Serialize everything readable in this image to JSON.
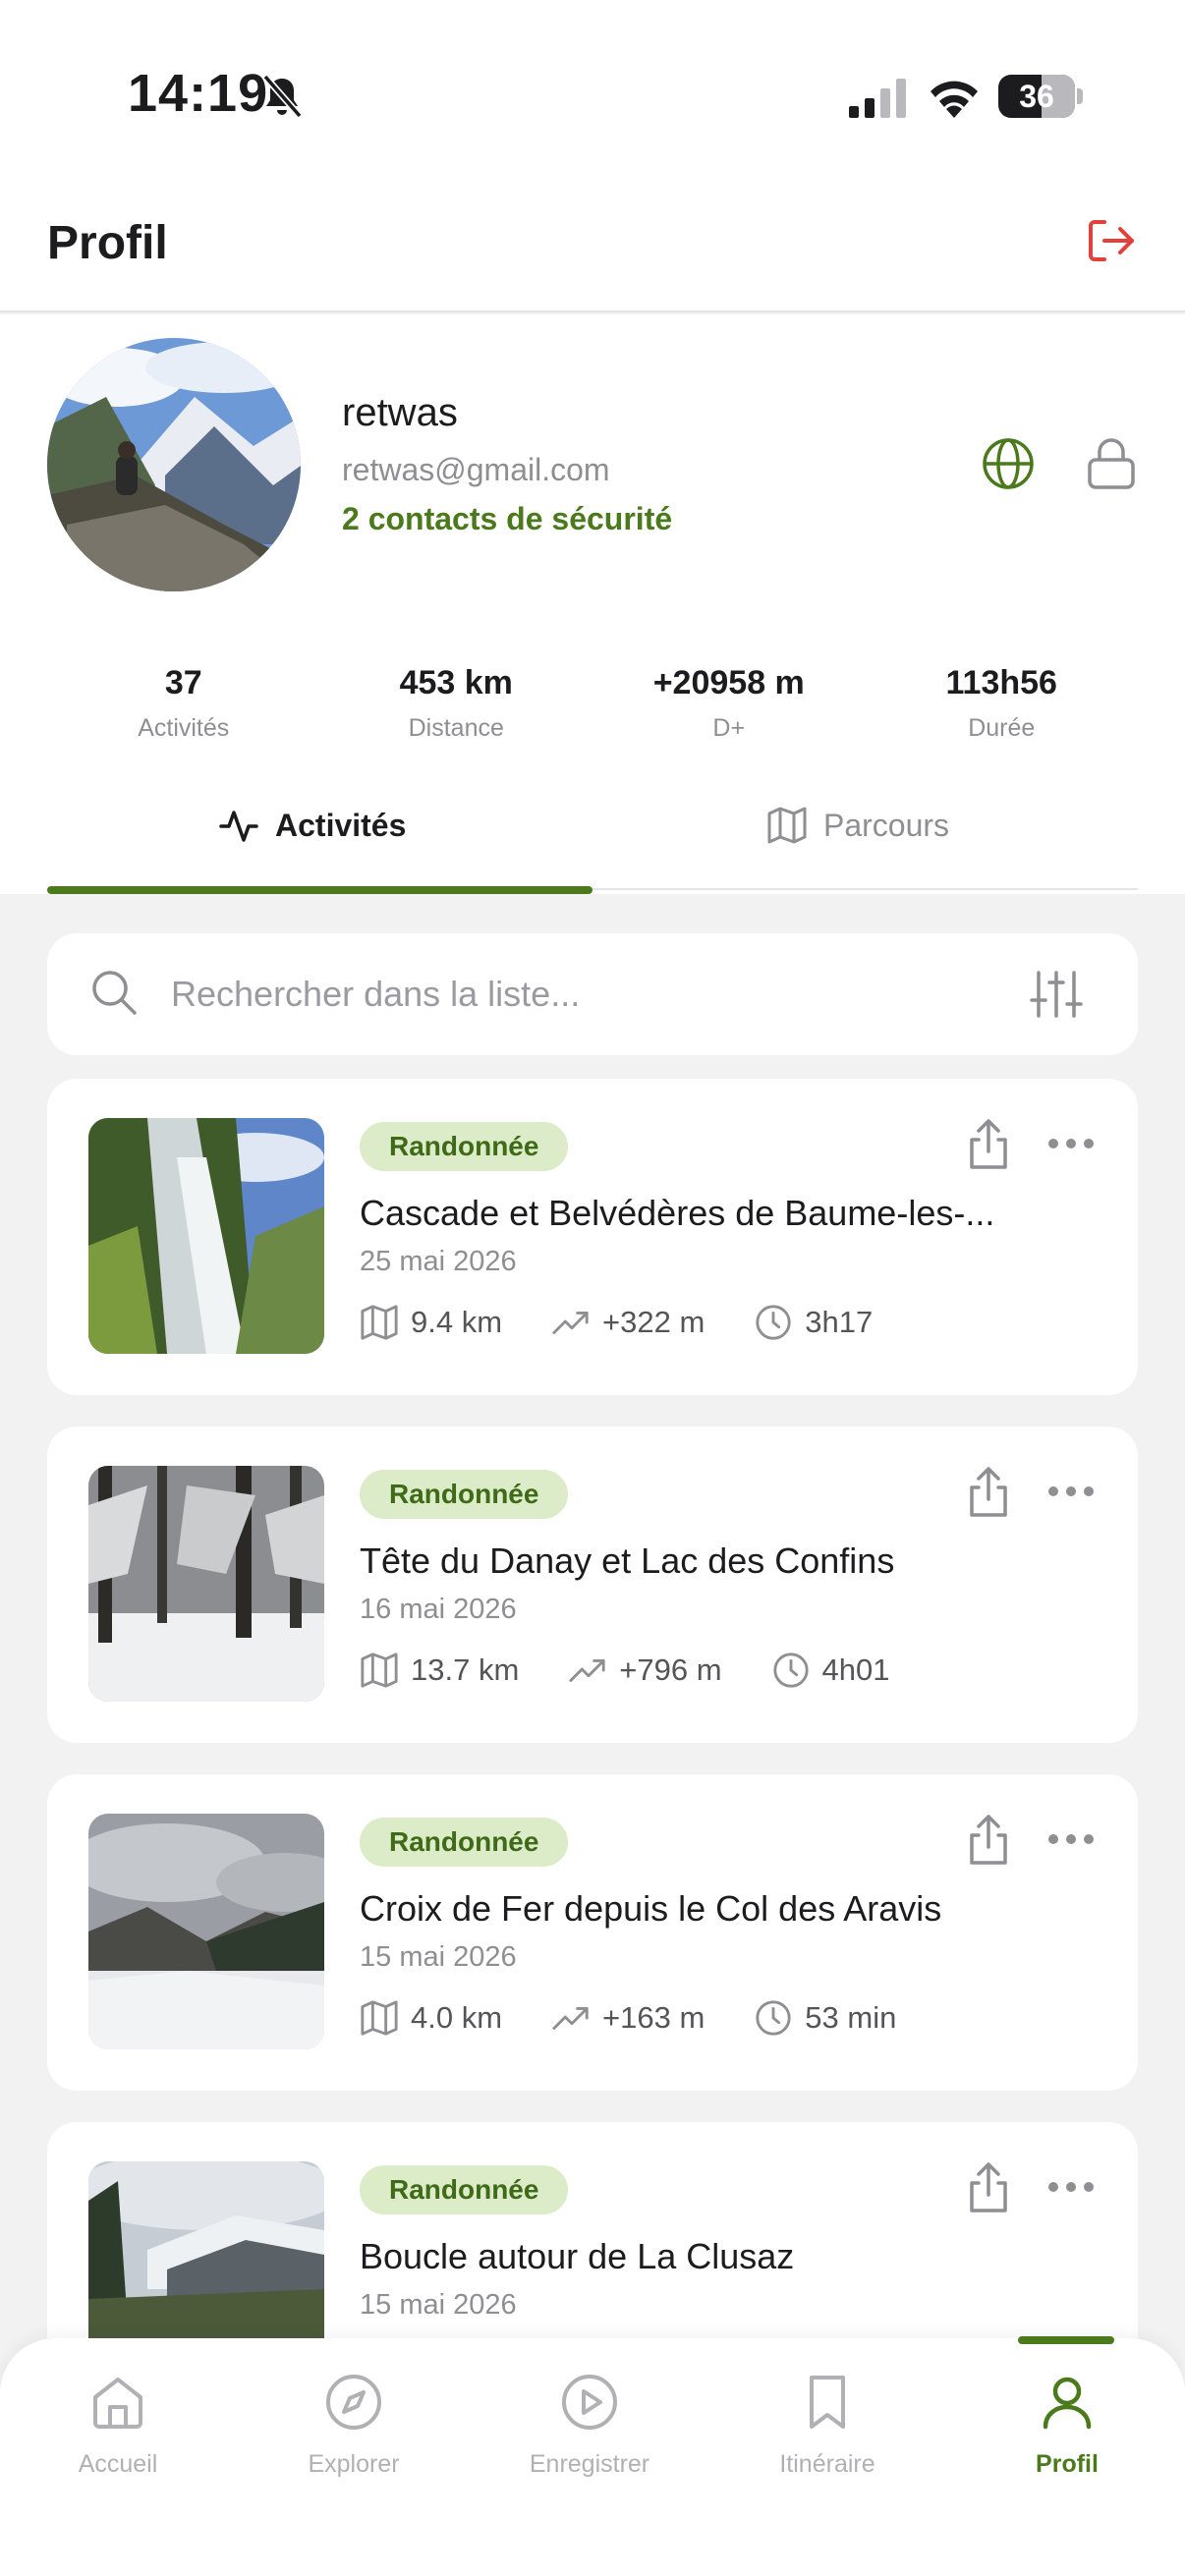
{
  "status_bar": {
    "time": "14:19",
    "battery": "36"
  },
  "header": {
    "title": "Profil"
  },
  "profile": {
    "username": "retwas",
    "email": "retwas@gmail.com",
    "contacts": "2 contacts de sécurité"
  },
  "stats": [
    {
      "value": "37",
      "label": "Activités"
    },
    {
      "value": "453 km",
      "label": "Distance"
    },
    {
      "value": "+20958 m",
      "label": "D+"
    },
    {
      "value": "113h56",
      "label": "Durée"
    }
  ],
  "tabs": [
    {
      "label": "Activités",
      "active": true
    },
    {
      "label": "Parcours",
      "active": false
    }
  ],
  "search": {
    "placeholder": "Rechercher dans la liste..."
  },
  "activities": [
    {
      "type": "Randonnée",
      "title": "Cascade et Belvédères de Baume-les-...",
      "date": "25 mai 2026",
      "distance": "9.4 km",
      "elevation": "+322 m",
      "duration": "3h17"
    },
    {
      "type": "Randonnée",
      "title": "Tête du Danay et Lac des Confins",
      "date": "16 mai 2026",
      "distance": "13.7 km",
      "elevation": "+796 m",
      "duration": "4h01"
    },
    {
      "type": "Randonnée",
      "title": "Croix de Fer depuis le Col des Aravis",
      "date": "15 mai 2026",
      "distance": "4.0 km",
      "elevation": "+163 m",
      "duration": "53 min"
    },
    {
      "type": "Randonnée",
      "title": "Boucle autour de La Clusaz",
      "date": "15 mai 2026"
    }
  ],
  "bottom_nav": [
    {
      "label": "Accueil",
      "icon": "home-icon",
      "active": false
    },
    {
      "label": "Explorer",
      "icon": "compass-icon",
      "active": false
    },
    {
      "label": "Enregistrer",
      "icon": "play-circle-icon",
      "active": false
    },
    {
      "label": "Itinéraire",
      "icon": "bookmark-icon",
      "active": false
    },
    {
      "label": "Profil",
      "icon": "user-icon",
      "active": true
    }
  ],
  "colors": {
    "accent": "#4a7a1c",
    "badge_bg": "#dcebc8",
    "logout": "#e0413a"
  }
}
